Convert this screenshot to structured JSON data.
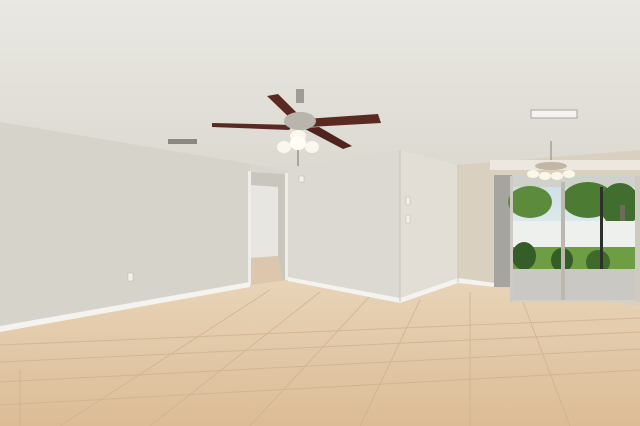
{
  "scene": {
    "description_elements": {
      "ceiling_fan": "ceiling-fan-with-light-kit",
      "chandelier": "chandelier",
      "sliding_door": "sliding-glass-door",
      "doorway": "open-doorway",
      "floor": "ceramic-tile-floor"
    },
    "colors": {
      "ceiling": "#e6e4dd",
      "wall_left": "#d8d5cd",
      "wall_center": "#dcdad3",
      "wall_right": "#ddd6c8",
      "baseboard": "#f4f3ef",
      "tile": "#e2c6a4",
      "grout": "#cdae8c",
      "fan_blade": "#5a2a22",
      "fan_metal": "#b9b4ac",
      "grass": "#6f9d43",
      "trees": "#3f6e2f",
      "fence": "#eef0ee",
      "door_frame": "#c9c4bb"
    }
  }
}
